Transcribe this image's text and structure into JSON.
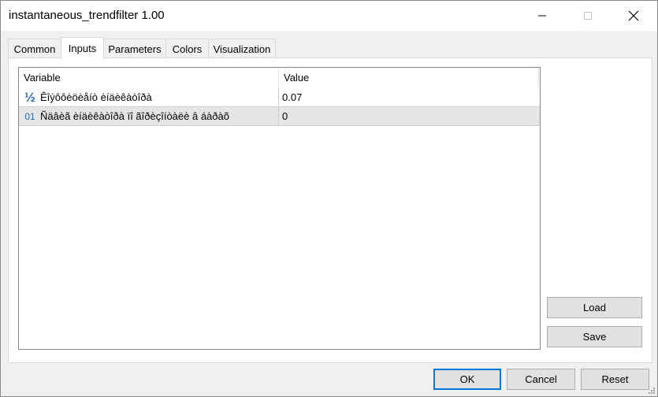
{
  "window": {
    "title": "instantaneous_trendfilter 1.00"
  },
  "tabs": [
    {
      "label": "Common",
      "active": false
    },
    {
      "label": "Inputs",
      "active": true
    },
    {
      "label": "Parameters",
      "active": false
    },
    {
      "label": "Colors",
      "active": false
    },
    {
      "label": "Visualization",
      "active": false
    }
  ],
  "grid": {
    "columns": [
      "Variable",
      "Value"
    ],
    "rows": [
      {
        "icon": "fraction-half-icon",
        "type_glyph": "½",
        "variable": "Êîýôôèöèåíò èíäèêàòîðà",
        "value": "0.07",
        "selected": false
      },
      {
        "icon": "integer-01-icon",
        "type_glyph": "01",
        "variable": "Ñäâèã èíäèêàòîðà ïî ãîðèçîíòàëè â áàðàõ",
        "value": "0",
        "selected": true
      }
    ]
  },
  "side_buttons": {
    "load": "Load",
    "save": "Save"
  },
  "footer_buttons": {
    "ok": "OK",
    "cancel": "Cancel",
    "reset": "Reset"
  },
  "colors": {
    "accent": "#0078d7",
    "icon_blue": "#2b6cb0"
  }
}
